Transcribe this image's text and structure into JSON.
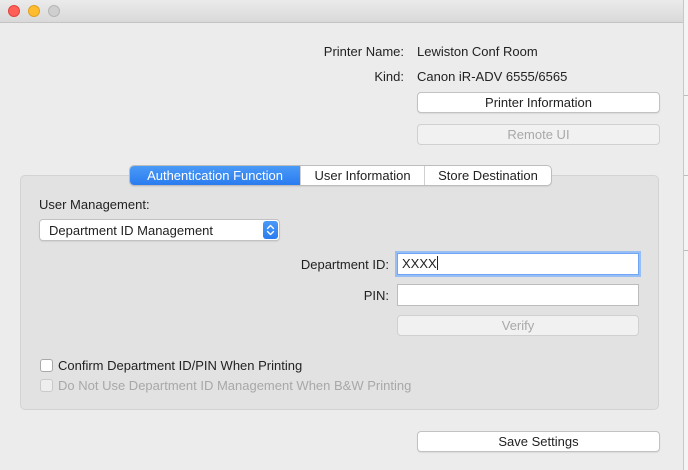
{
  "window": {
    "controls": [
      "close",
      "minimize",
      "zoom"
    ]
  },
  "printer": {
    "name_label": "Printer Name:",
    "name_value": "Lewiston Conf Room",
    "kind_label": "Kind:",
    "kind_value": "Canon iR-ADV 6555/6565"
  },
  "buttons": {
    "printer_info": "Printer Information",
    "remote_ui": "Remote UI",
    "verify": "Verify",
    "save_settings": "Save Settings"
  },
  "tabs": [
    {
      "label": "Authentication Function",
      "selected": true
    },
    {
      "label": "User Information",
      "selected": false
    },
    {
      "label": "Store Destination",
      "selected": false
    }
  ],
  "auth": {
    "user_management_label": "User Management:",
    "user_management_value": "Department ID Management",
    "department_id_label": "Department ID:",
    "department_id_value": "XXXX",
    "pin_label": "PIN:",
    "pin_value": "",
    "confirm_checkbox_label": "Confirm Department ID/PIN When Printing",
    "confirm_checkbox_checked": false,
    "bw_checkbox_label": "Do Not Use Department ID Management When B&W Printing",
    "bw_checkbox_checked": false,
    "bw_checkbox_enabled": false
  },
  "colors": {
    "accent": "#2a7cf0",
    "close": "#fe5f57",
    "minimize": "#febc2e",
    "zoom_inactive": "#cfcfcf"
  }
}
